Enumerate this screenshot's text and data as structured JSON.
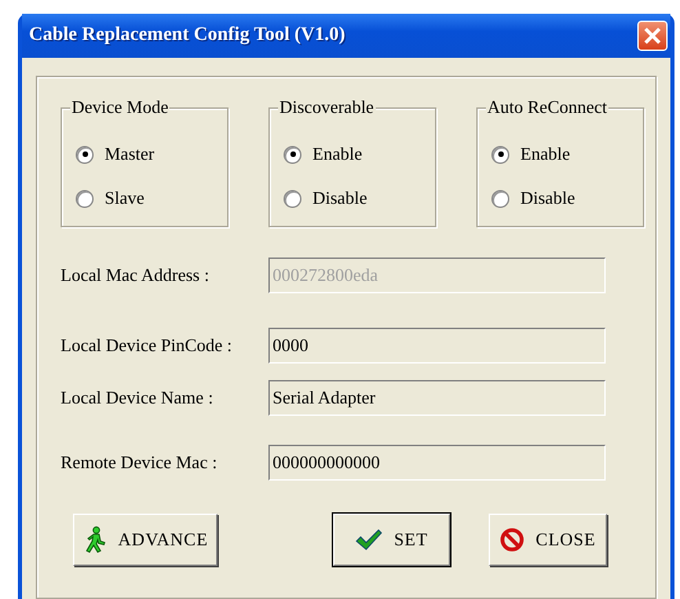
{
  "window": {
    "title": "Cable Replacement Config Tool (V1.0)"
  },
  "groups": [
    {
      "title": "Device Mode",
      "options": [
        {
          "label": "Master",
          "selected": true
        },
        {
          "label": "Slave",
          "selected": false
        }
      ]
    },
    {
      "title": "Discoverable",
      "options": [
        {
          "label": "Enable",
          "selected": true
        },
        {
          "label": "Disable",
          "selected": false
        }
      ]
    },
    {
      "title": "Auto ReConnect",
      "options": [
        {
          "label": "Enable",
          "selected": true
        },
        {
          "label": "Disable",
          "selected": false
        }
      ]
    }
  ],
  "fields": [
    {
      "label": "Local Mac Address :",
      "value": "000272800eda",
      "disabled": true
    },
    {
      "label": "Local Device PinCode :",
      "value": "0000",
      "disabled": false
    },
    {
      "label": "Local Device Name :",
      "value": "Serial Adapter",
      "disabled": false
    },
    {
      "label": "Remote Device Mac :",
      "value": "000000000000",
      "disabled": false
    }
  ],
  "buttons": [
    {
      "label": "ADVANCE",
      "kind": "advance",
      "default": false
    },
    {
      "label": "SET",
      "kind": "set",
      "default": true
    },
    {
      "label": "CLOSE",
      "kind": "close",
      "default": false
    }
  ]
}
